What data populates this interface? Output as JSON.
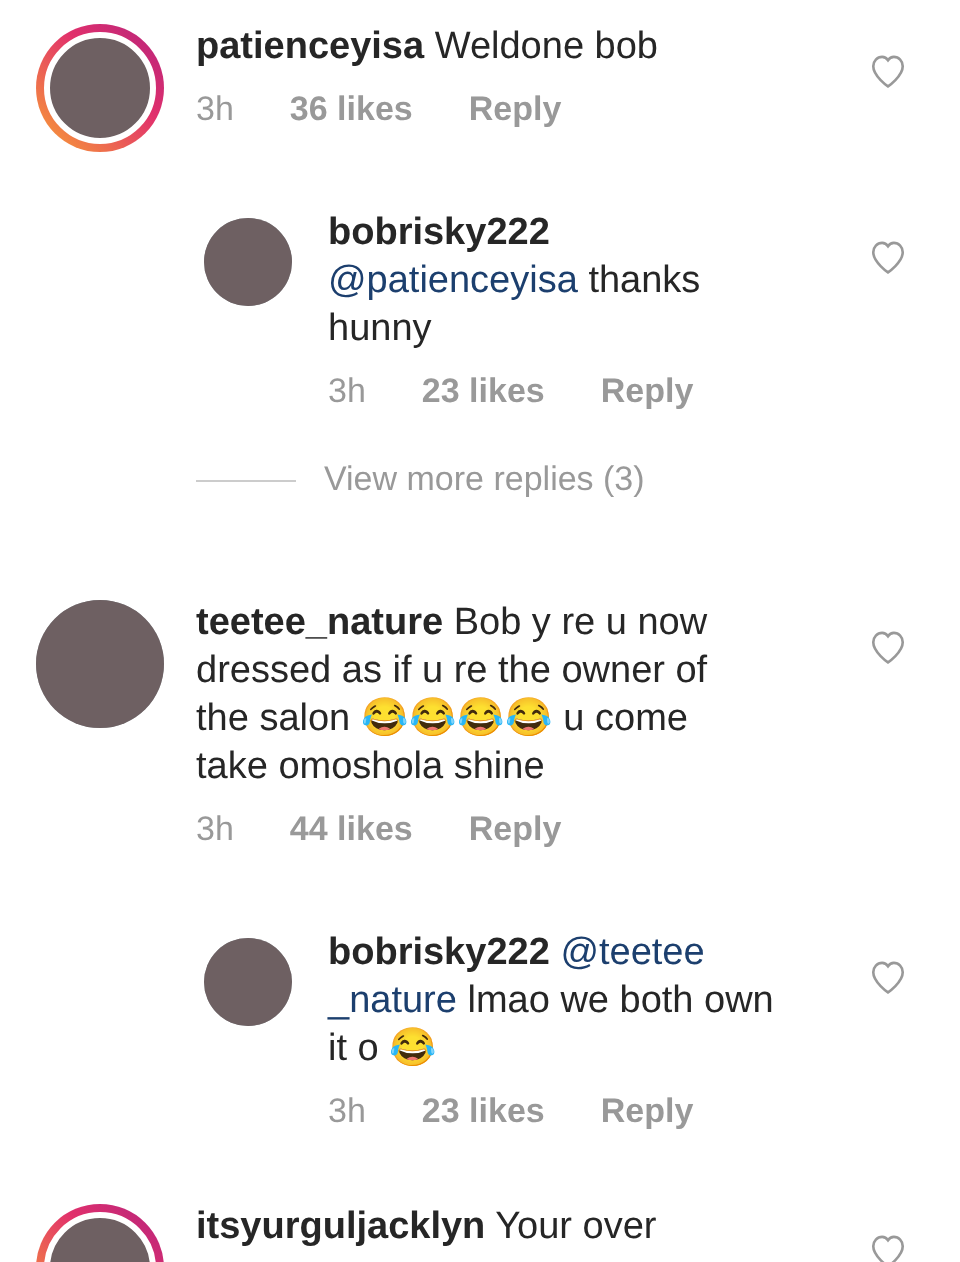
{
  "comments": [
    {
      "kind": "comment",
      "story_ring": true,
      "username": "patienceyisa",
      "text": "Weldone bob",
      "time": "3h",
      "likes": "36 likes",
      "reply": "Reply"
    },
    {
      "kind": "reply",
      "story_ring": false,
      "username": "bobrisky222",
      "mention": "@patienceyisa",
      "text": "thanks hunny",
      "time": "3h",
      "likes": "23 likes",
      "reply": "Reply"
    },
    {
      "kind": "more",
      "label": "View more replies (3)"
    },
    {
      "kind": "comment",
      "story_ring": false,
      "username": "teetee_nature",
      "text": "Bob y re u now dressed as if u re the owner of the salon 😂😂😂😂 u come take omoshola shine",
      "time": "3h",
      "likes": "44 likes",
      "reply": "Reply"
    },
    {
      "kind": "reply",
      "story_ring": false,
      "username": "bobrisky222",
      "mention": "@teetee _nature",
      "text": "lmao we both own it o 😂",
      "time": "3h",
      "likes": "23 likes",
      "reply": "Reply"
    },
    {
      "kind": "comment",
      "story_ring": true,
      "username": "itsyurguljacklyn",
      "text": "Your over"
    }
  ]
}
